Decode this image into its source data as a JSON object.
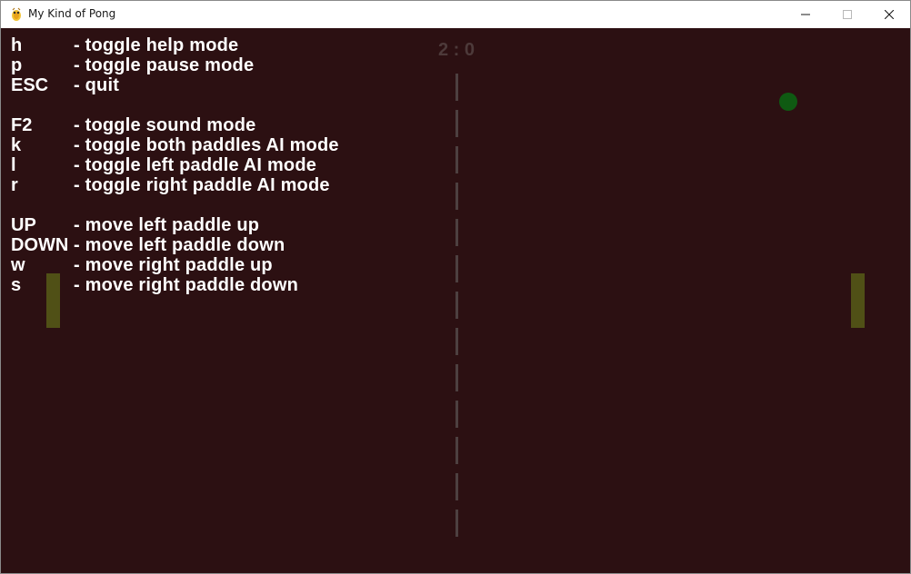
{
  "window": {
    "title": "My Kind of Pong"
  },
  "score": "2 : 0",
  "help": {
    "groups": [
      [
        {
          "key": "h",
          "desc": "- toggle help mode"
        },
        {
          "key": "p",
          "desc": "- toggle pause mode"
        },
        {
          "key": "ESC",
          "desc": "- quit"
        }
      ],
      [
        {
          "key": "F2",
          "desc": "- toggle sound mode"
        },
        {
          "key": "k",
          "desc": "- toggle both paddles AI mode"
        },
        {
          "key": "l",
          "desc": "- toggle left paddle AI mode"
        },
        {
          "key": "r",
          "desc": "- toggle right paddle AI mode"
        }
      ],
      [
        {
          "key": "UP",
          "desc": "- move left paddle up"
        },
        {
          "key": "DOWN",
          "desc": "- move left paddle down"
        },
        {
          "key": "w",
          "desc": "- move right paddle up"
        },
        {
          "key": "s",
          "desc": "- move right paddle down"
        }
      ]
    ]
  },
  "colors": {
    "background": "#2c1012",
    "help_text": "#ffffff",
    "score_text": "#4d3a3a",
    "net": "#4d4040",
    "paddle": "#505016",
    "ball": "#0f5a12"
  },
  "icons": {
    "app": "pygame-snake-icon",
    "minimize": "minimize-icon",
    "maximize": "maximize-icon",
    "close": "close-icon"
  }
}
